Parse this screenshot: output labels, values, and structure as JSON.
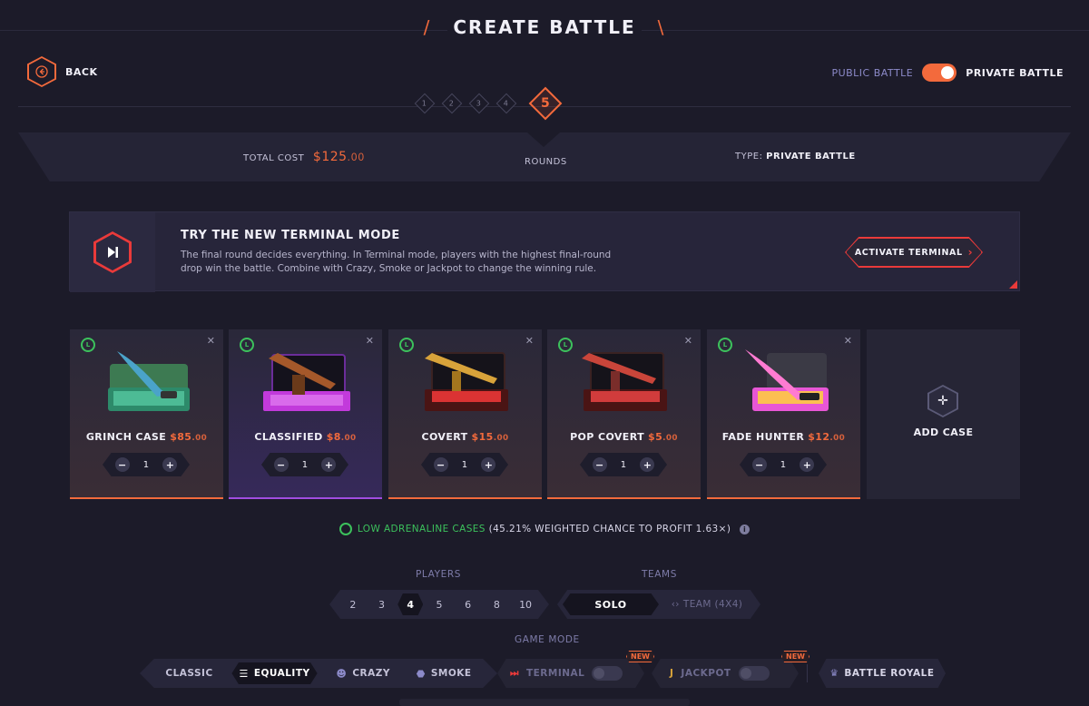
{
  "header": {
    "title": "CREATE BATTLE",
    "back_label": "BACK"
  },
  "privacy": {
    "public_label": "PUBLIC BATTLE",
    "private_label": "PRIVATE BATTLE",
    "private_enabled": true
  },
  "rounds": {
    "steps": [
      "1",
      "2",
      "3",
      "4",
      "5"
    ],
    "active": "5",
    "label": "ROUNDS"
  },
  "summary": {
    "total_cost_label": "TOTAL COST",
    "total_cost_main": "$125",
    "total_cost_dec": ".00",
    "type_label": "TYPE:",
    "type_value": "PRIVATE BATTLE"
  },
  "banner": {
    "title": "TRY THE NEW TERMINAL MODE",
    "text": "The final round decides everything. In Terminal mode, players with the highest final-round drop win the battle. Combine with Crazy, Smoke or Jackpot to change the winning rule.",
    "button": "ACTIVATE TERMINAL"
  },
  "cases": [
    {
      "name": "GRINCH CASE",
      "price_main": "$85",
      "price_dec": ".00",
      "qty": "1",
      "level": "L",
      "theme": "orange",
      "icon": "knife-green-case"
    },
    {
      "name": "CLASSIFIED",
      "price_main": "$8",
      "price_dec": ".00",
      "qty": "1",
      "level": "L",
      "theme": "purple",
      "icon": "rifle-purple-case"
    },
    {
      "name": "COVERT",
      "price_main": "$15",
      "price_dec": ".00",
      "qty": "1",
      "level": "L",
      "theme": "orange",
      "icon": "gold-rifle-red-case"
    },
    {
      "name": "POP COVERT",
      "price_main": "$5",
      "price_dec": ".00",
      "qty": "1",
      "level": "L",
      "theme": "orange",
      "icon": "rifle-red-case"
    },
    {
      "name": "FADE HUNTER",
      "price_main": "$12",
      "price_dec": ".00",
      "qty": "1",
      "level": "L",
      "theme": "orange",
      "icon": "fade-knife-case"
    }
  ],
  "add_case_label": "ADD CASE",
  "profit": {
    "highlight": "LOW ADRENALINE CASES",
    "rest": "(45.21% WEIGHTED CHANCE TO PROFIT 1.63×)"
  },
  "players": {
    "label": "PLAYERS",
    "options": [
      "2",
      "3",
      "4",
      "5",
      "6",
      "8",
      "10"
    ],
    "selected": "4"
  },
  "teams": {
    "label": "TEAMS",
    "solo": "SOLO",
    "team": "TEAM (4X4)"
  },
  "game_mode": {
    "label": "GAME MODE",
    "modes": [
      "CLASSIC",
      "EQUALITY",
      "CRAZY",
      "SMOKE"
    ],
    "selected": "EQUALITY",
    "terminal": "TERMINAL",
    "jackpot": "JACKPOT",
    "new_badge": "NEW",
    "battle_royale": "BATTLE ROYALE"
  },
  "colors": {
    "accent": "#f36a3c",
    "green": "#3cc15c",
    "red": "#ea3a3a",
    "purple": "#a04de0",
    "background": "#1c1b29"
  }
}
